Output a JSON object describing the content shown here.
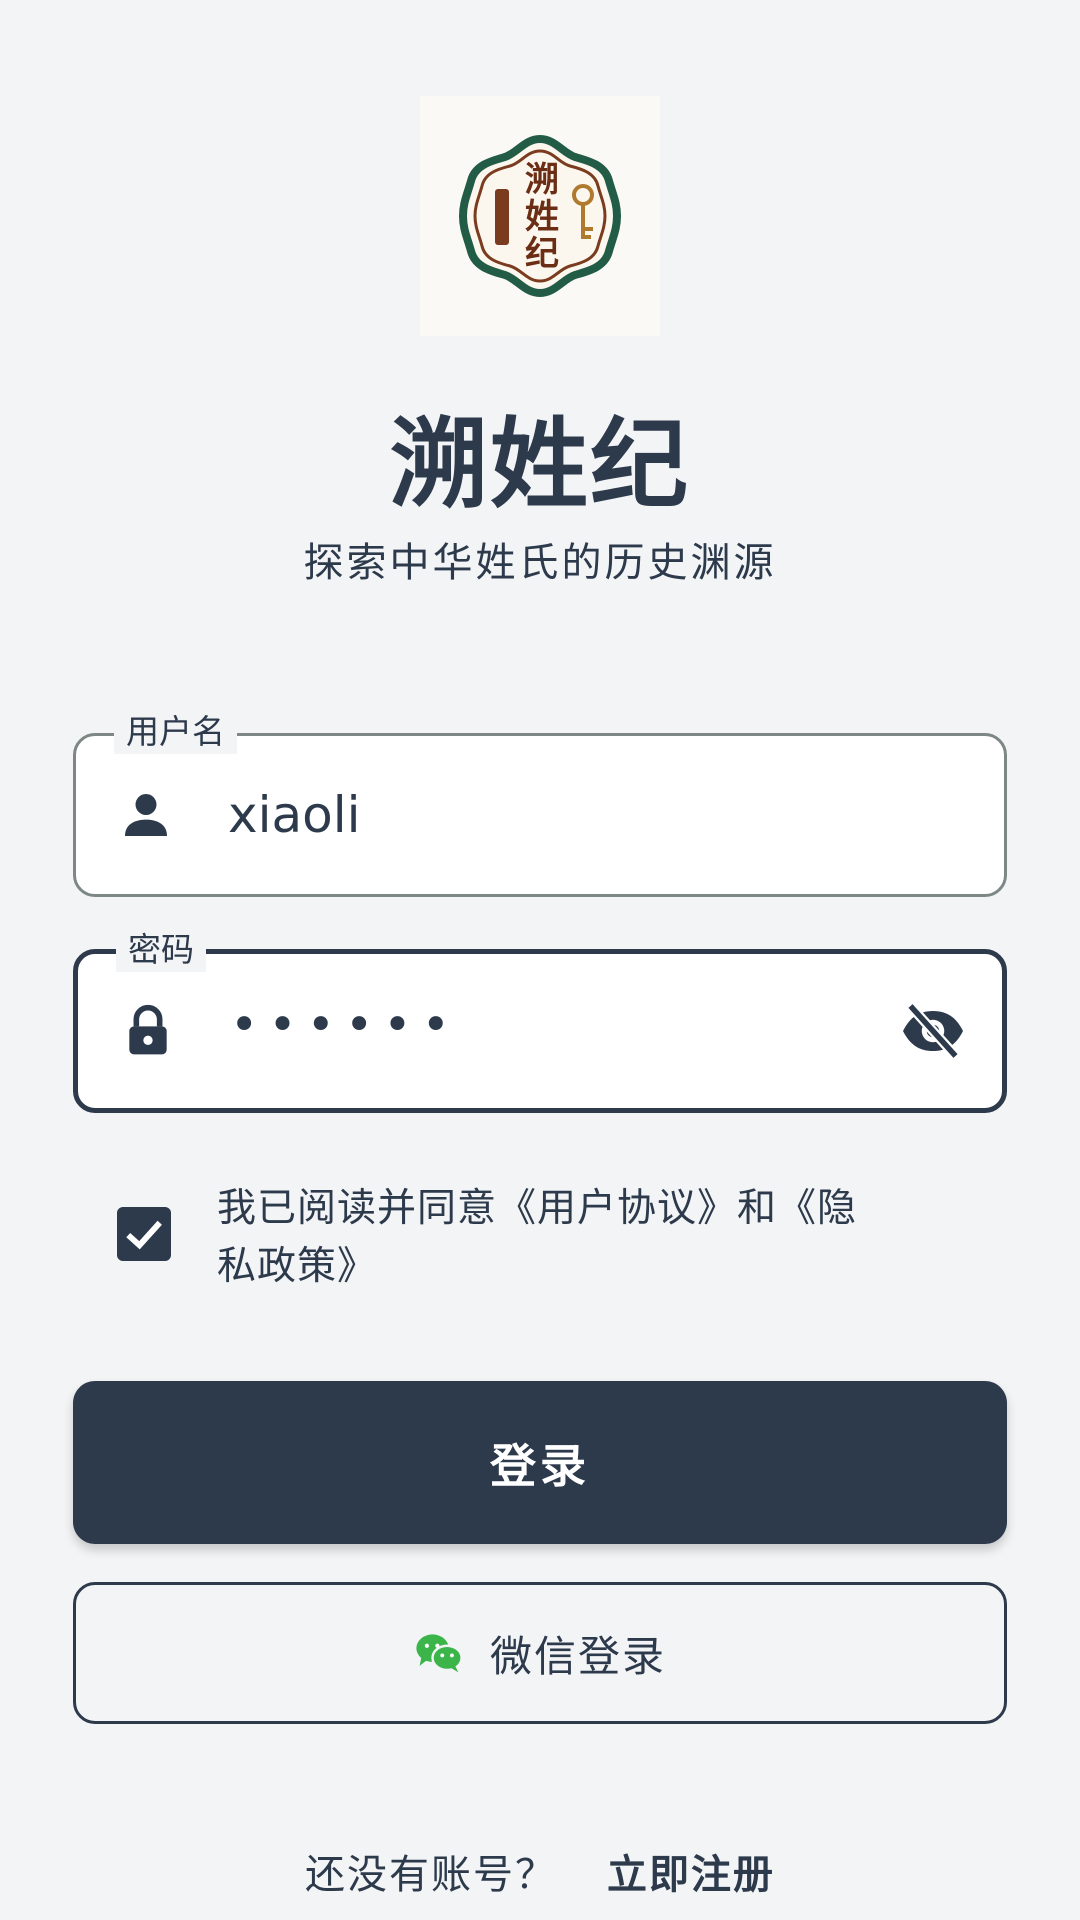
{
  "app": {
    "logo_text": [
      "溯",
      "姓",
      "纪"
    ],
    "title": "溯姓纪",
    "subtitle": "探索中华姓氏的历史渊源"
  },
  "form": {
    "username": {
      "label": "用户名",
      "value": "xiaoli",
      "icon": "person-icon"
    },
    "password": {
      "label": "密码",
      "value": "••••••",
      "icon": "lock-icon",
      "toggle_icon": "eye-off-icon"
    },
    "agreement": {
      "checked": true,
      "text": "我已阅读并同意《用户协议》和《隐私政策》"
    }
  },
  "buttons": {
    "login": "登录",
    "wechat_login": "微信登录"
  },
  "footer": {
    "prompt": "还没有账号？",
    "register": "立即注册"
  },
  "colors": {
    "primary": "#2d3a4c",
    "background": "#f3f4f6",
    "wechat_green": "#3bb54a"
  }
}
